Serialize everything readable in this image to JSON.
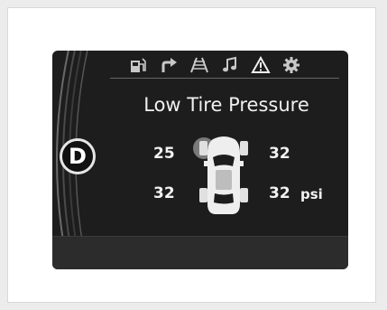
{
  "title": "Low Tire Pressure",
  "gear": "D",
  "tires": {
    "front_left": "25",
    "front_right": "32",
    "rear_left": "32",
    "rear_right": "32"
  },
  "unit": "psi",
  "status_icons": [
    "fuel-station-icon",
    "turn-arrow-icon",
    "lane-road-icon",
    "music-note-icon",
    "warning-triangle-icon",
    "settings-gear-icon"
  ],
  "colors": {
    "screen_bg": "#1d1d1d",
    "text": "#f0f0f0",
    "icon": "#c8c8c8",
    "low_tire_highlight": "#8a8a8a"
  }
}
